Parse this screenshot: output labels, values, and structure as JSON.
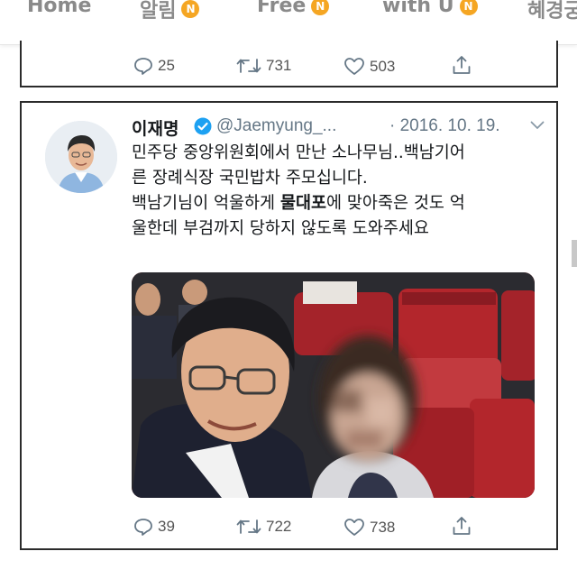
{
  "nav": {
    "items": [
      {
        "label": "Home",
        "badge": ""
      },
      {
        "label": "알림",
        "badge": "N"
      },
      {
        "label": "Free",
        "badge": "N"
      },
      {
        "label": "with U",
        "badge": "N"
      },
      {
        "label": "혜경궁",
        "badge": ""
      }
    ]
  },
  "prev_tweet": {
    "replies": "25",
    "retweets": "731",
    "likes": "503"
  },
  "tweet": {
    "name": "이재명",
    "handle": "@Jaemyung_...",
    "date": "· 2016. 10. 19.",
    "lines": [
      "민주당 중앙위원회에서 만난 소나무님..백남기어",
      "른 장례식장 국민밥차 주모십니다.",
      "백남기님이 억울하게 물대포에 맞아죽은 것도 억",
      "울한데 부검까지 당하지 않도록 도와주세요"
    ],
    "bold_word": "물대포",
    "replies": "39",
    "retweets": "722",
    "likes": "738"
  },
  "colors": {
    "nav_text": "#8a8a8a",
    "badge": "#f5a623",
    "verified": "#1da1f2",
    "seat_red": "#b3262c"
  }
}
